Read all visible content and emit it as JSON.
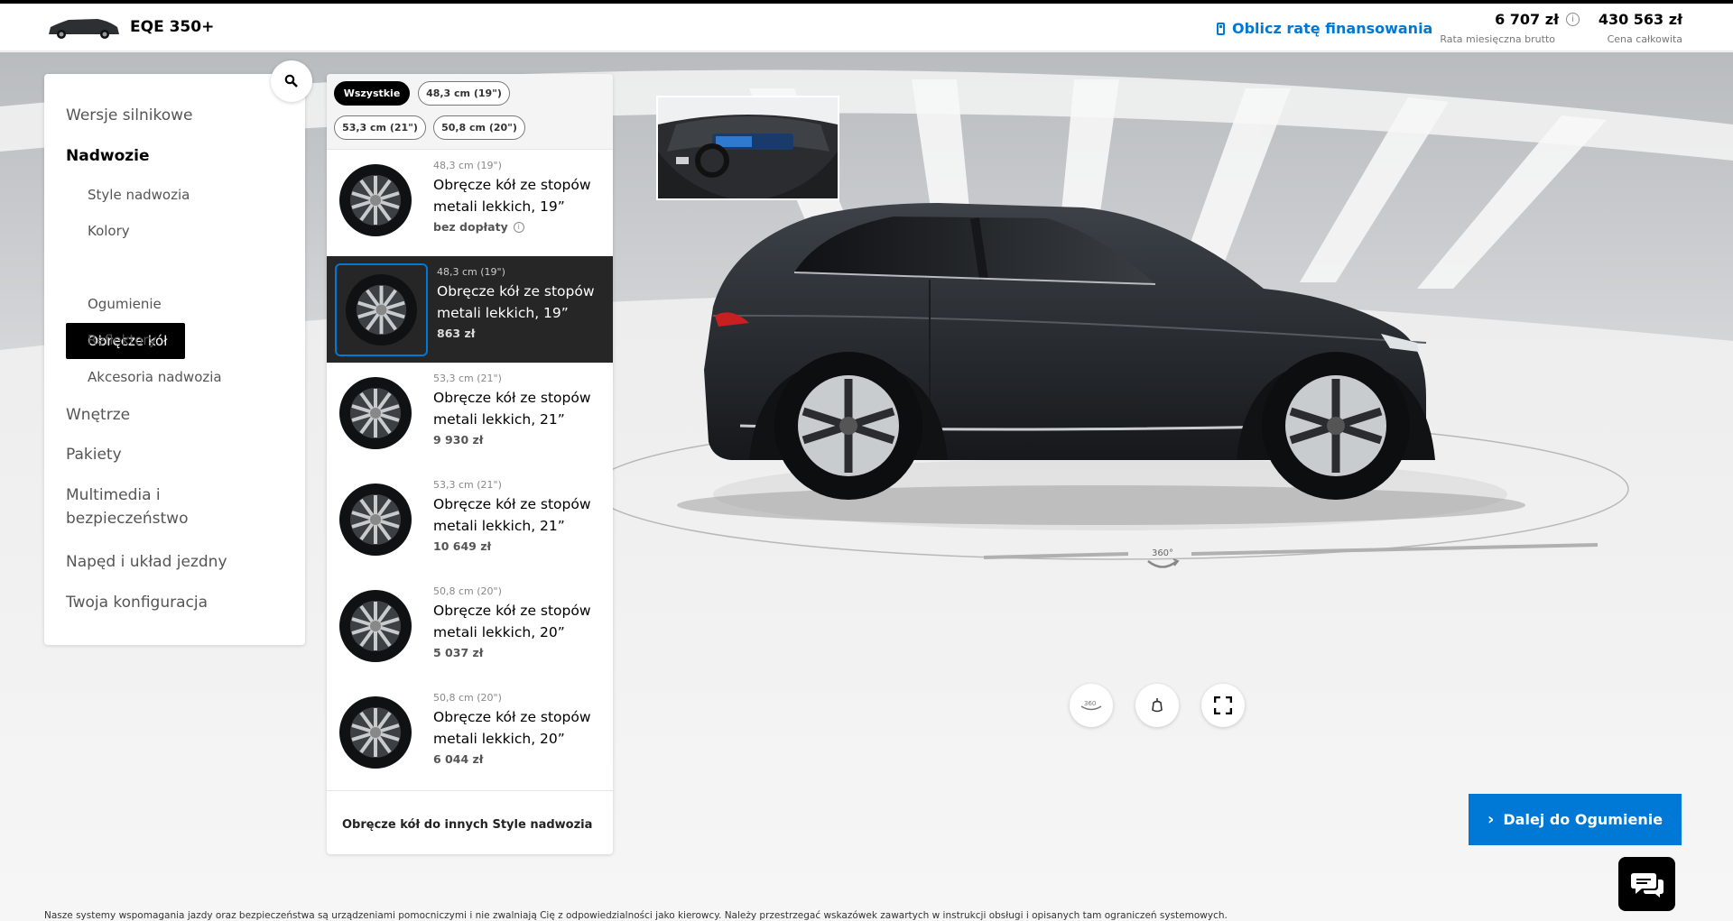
{
  "header": {
    "model": "EQE 350+",
    "finance_link": "Oblicz ratę finansowania",
    "monthly_value": "6 707 zł",
    "monthly_label": "Rata miesięczna brutto",
    "total_value": "430 563 zł",
    "total_label": "Cena całkowita"
  },
  "nav": {
    "items": [
      {
        "label": "Wersje silnikowe"
      },
      {
        "label": "Nadwozie"
      },
      {
        "label": "Style nadwozia"
      },
      {
        "label": "Kolory"
      },
      {
        "label": "Obręcze kół"
      },
      {
        "label": "Ogumienie"
      },
      {
        "label": "Reflektory"
      },
      {
        "label": "Akcesoria nadwozia"
      },
      {
        "label": "Wnętrze"
      },
      {
        "label": "Pakiety"
      },
      {
        "label": "Multimedia i"
      },
      {
        "label": "bezpieczeństwo"
      },
      {
        "label": "Napęd i układ jezdny"
      },
      {
        "label": "Twoja konfiguracja"
      }
    ]
  },
  "filters": [
    "Wszystkie",
    "48,3 cm (19\")",
    "53,3 cm (21\")",
    "50,8 cm (20\")"
  ],
  "rims": [
    {
      "size": "48,3 cm (19\")",
      "line1": "Obręcze kół ze stopów",
      "line2": "metali lekkich, 19”",
      "price": "bez dopłaty"
    },
    {
      "size": "48,3 cm (19\")",
      "line1": "Obręcze kół ze stopów",
      "line2": "metali lekkich, 19”",
      "price": "863 zł"
    },
    {
      "size": "53,3 cm (21\")",
      "line1": "Obręcze kół ze stopów",
      "line2": "metali lekkich, 21”",
      "price": "9 930 zł"
    },
    {
      "size": "53,3 cm (21\")",
      "line1": "Obręcze kół ze stopów",
      "line2": "metali lekkich, 21”",
      "price": "10 649 zł"
    },
    {
      "size": "50,8 cm (20\")",
      "line1": "Obręcze kół ze stopów",
      "line2": "metali lekkich, 20”",
      "price": "5 037 zł"
    },
    {
      "size": "50,8 cm (20\")",
      "line1": "Obręcze kół ze stopów",
      "line2": "metali lekkich, 20”",
      "price": "6 044 zł"
    }
  ],
  "other_link": "Obręcze kół do innych Style nadwozia",
  "stage": {
    "rotate_label": "360°"
  },
  "next_button": "Dalej do Ogumienie",
  "disclaimer": "Nasze systemy wspomagania jazdy oraz bezpieczeństwa są urządzeniami pomocniczymi i nie zwalniają Cię z odpowiedzialności jako kierowcy. Należy przestrzegać wskazówek zawartych w instrukcji obsługi i opisanych tam ograniczeń systemowych.",
  "colors": {
    "accent": "#0078d6",
    "selected_bg": "#262626"
  },
  "icons": [
    "calculator-icon",
    "info-icon",
    "search-icon",
    "rotate-360-icon",
    "light-icon",
    "fullscreen-icon",
    "chevron-right-icon",
    "chat-icon"
  ]
}
